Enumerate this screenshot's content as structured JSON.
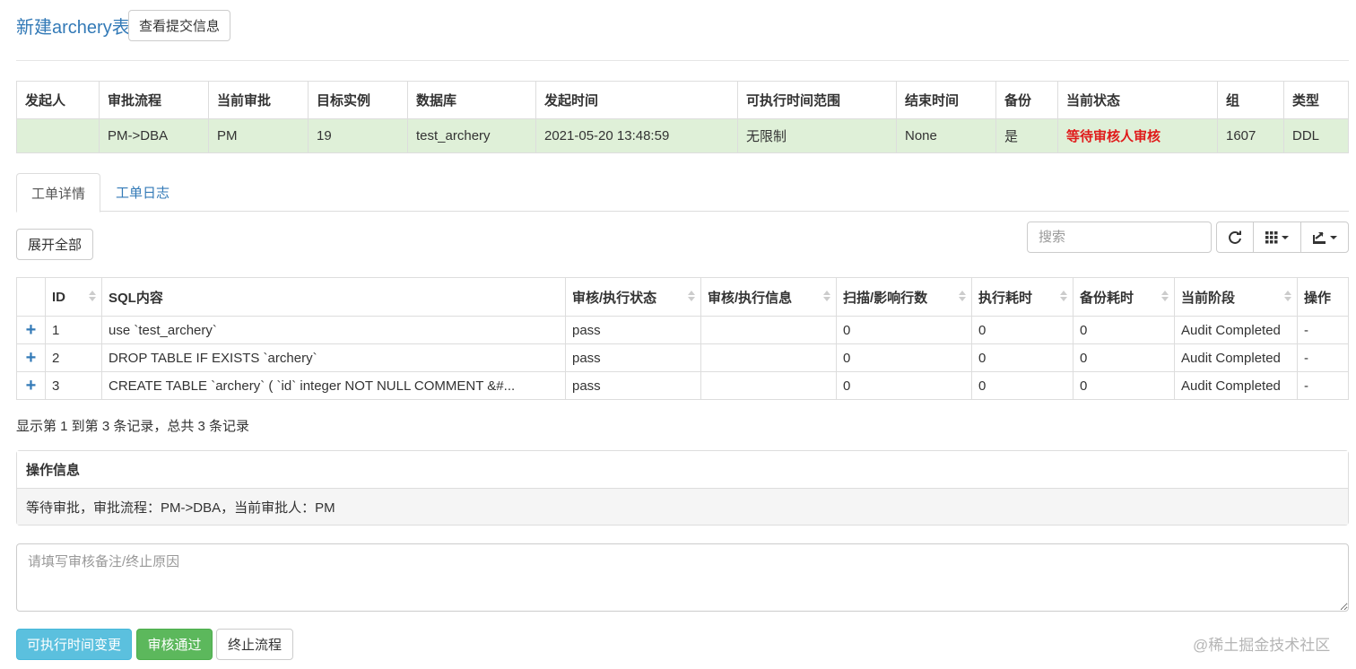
{
  "header": {
    "title": "新建archery表",
    "view_submit_label": "查看提交信息"
  },
  "summary": {
    "headers": [
      "发起人",
      "审批流程",
      "当前审批",
      "目标实例",
      "数据库",
      "发起时间",
      "可执行时间范围",
      "结束时间",
      "备份",
      "当前状态",
      "组",
      "类型"
    ],
    "row": {
      "initiator": "",
      "workflow": "PM->DBA",
      "current_approver": "PM",
      "instance": "19",
      "database": "test_archery",
      "start_time": "2021-05-20 13:48:59",
      "exec_range": "无限制",
      "end_time": "None",
      "backup": "是",
      "status": "等待审核人审核",
      "group": "1607",
      "type": "DDL"
    },
    "status_color": "#e01a1a",
    "row_bg": "#dff0d8"
  },
  "tabs": [
    "工单详情",
    "工单日志"
  ],
  "toolbar": {
    "expand_all": "展开全部",
    "search_placeholder": "搜索",
    "refresh_icon": "refresh-icon",
    "columns_icon": "columns-icon",
    "export_icon": "export-icon"
  },
  "detail": {
    "headers": [
      "ID",
      "SQL内容",
      "审核/执行状态",
      "审核/执行信息",
      "扫描/影响行数",
      "执行耗时",
      "备份耗时",
      "当前阶段",
      "操作"
    ],
    "rows": [
      {
        "id": "1",
        "sql": "use `test_archery`",
        "status": "pass",
        "info": "",
        "rows": "0",
        "exec_time": "0",
        "backup_time": "0",
        "stage": "Audit Completed",
        "op": "-"
      },
      {
        "id": "2",
        "sql": "DROP TABLE IF EXISTS `archery`",
        "status": "pass",
        "info": "",
        "rows": "0",
        "exec_time": "0",
        "backup_time": "0",
        "stage": "Audit Completed",
        "op": "-"
      },
      {
        "id": "3",
        "sql": "CREATE TABLE `archery` ( `id` integer NOT NULL COMMENT &#...",
        "status": "pass",
        "info": "",
        "rows": "0",
        "exec_time": "0",
        "backup_time": "0",
        "stage": "Audit Completed",
        "op": "-"
      }
    ],
    "expand_symbol": "+"
  },
  "pagination": {
    "info": "显示第 1 到第 3 条记录，总共 3 条记录"
  },
  "panel": {
    "title": "操作信息",
    "body": "等待审批，审批流程：PM->DBA，当前审批人：PM"
  },
  "remark": {
    "placeholder": "请填写审核备注/终止原因"
  },
  "actions": {
    "change_time": "可执行时间变更",
    "approve": "审核通过",
    "terminate": "终止流程"
  },
  "watermark": "@稀土掘金技术社区"
}
